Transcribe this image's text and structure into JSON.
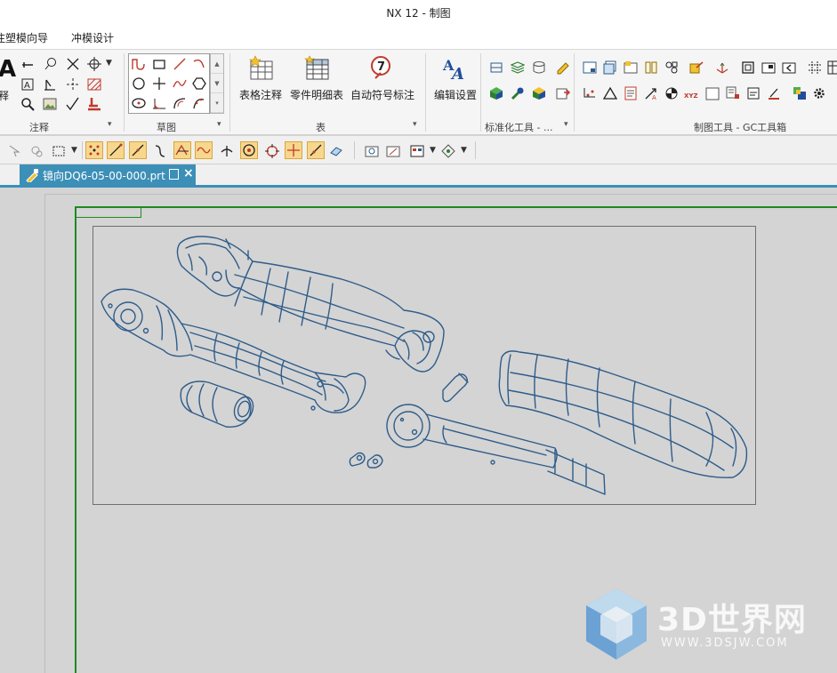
{
  "window": {
    "title": "NX 12 - 制图"
  },
  "menu": {
    "items": [
      "注塑模向导",
      "冲模设计"
    ]
  },
  "ribbon": {
    "groups": {
      "annotation": {
        "label": "注释",
        "partial_label": "释"
      },
      "sketch": {
        "label": "草图"
      },
      "table": {
        "label": "表",
        "buttons": [
          "表格注释",
          "零件明细表",
          "自动符号标注"
        ]
      },
      "edit": {
        "button": "编辑设置"
      },
      "standard": {
        "label": "标准化工具 - ..."
      },
      "drafting": {
        "label": "制图工具 - GC工具箱"
      }
    }
  },
  "tab": {
    "label": "镜向DQ6-05-00-000.prt"
  },
  "watermark": {
    "brand": "3D世界网",
    "url": "WWW.3DSJW.COM"
  },
  "colors": {
    "accent": "#3c8fb7",
    "border_green": "#1e8a1e",
    "line_blue": "#2e5c8a",
    "background": "#d4d4d4"
  }
}
